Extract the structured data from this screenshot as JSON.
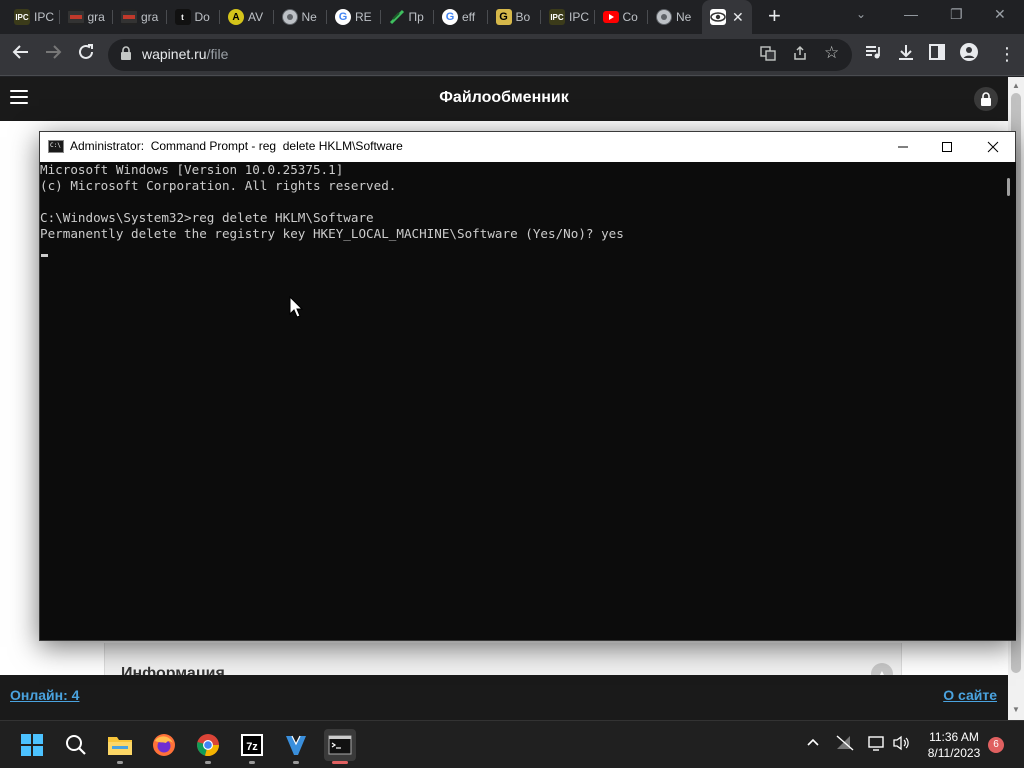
{
  "browser": {
    "tabs": [
      {
        "title": "IPC",
        "favicon_text": "IPC",
        "color": "#3b3b1a"
      },
      {
        "title": "gra",
        "favicon_text": "",
        "color": "#8a1d1d"
      },
      {
        "title": "gra",
        "favicon_text": "",
        "color": "#8a1d1d"
      },
      {
        "title": "Do",
        "favicon_text": "t",
        "color": "#111111"
      },
      {
        "title": "AV",
        "favicon_text": "A",
        "color": "#d4c41a"
      },
      {
        "title": "Ne",
        "favicon_text": "",
        "color": "#5f6368"
      },
      {
        "title": "RE",
        "favicon_text": "G",
        "color": "#ffffff"
      },
      {
        "title": "Пр",
        "favicon_text": "",
        "color": "#2f6f3a"
      },
      {
        "title": "eff",
        "favicon_text": "G",
        "color": "#ffffff"
      },
      {
        "title": "Bo",
        "favicon_text": "G",
        "color": "#d6b84a"
      },
      {
        "title": "IPC",
        "favicon_text": "IPC",
        "color": "#3b3b1a"
      },
      {
        "title": "Co",
        "favicon_text": "",
        "color": "#ff0000"
      },
      {
        "title": "Ne",
        "favicon_text": "",
        "color": "#5f6368"
      }
    ],
    "url_host": "wapinet.ru",
    "url_path": "/file"
  },
  "site": {
    "title": "Файлообменник",
    "info_label": "Информация",
    "footer_left": "Онлайн: 4",
    "footer_right": "О сайте"
  },
  "cmd": {
    "title": "Administrator:  Command Prompt - reg  delete HKLM\\Software",
    "lines": [
      "Microsoft Windows [Version 10.0.25375.1]",
      "(c) Microsoft Corporation. All rights reserved.",
      "",
      "C:\\Windows\\System32>reg delete HKLM\\Software",
      "Permanently delete the registry key HKEY_LOCAL_MACHINE\\Software (Yes/No)? yes"
    ]
  },
  "taskbar": {
    "apps": [
      "windows-start",
      "search",
      "file-explorer",
      "firefox",
      "chrome",
      "7zip",
      "visual-studio",
      "command-prompt"
    ],
    "time": "11:36 AM",
    "date": "8/11/2023",
    "notification_count": "6"
  }
}
